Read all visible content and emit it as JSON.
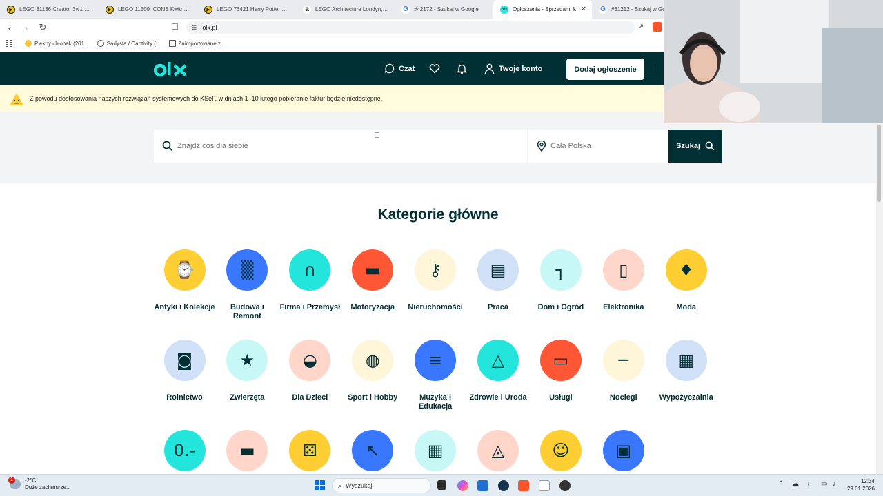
{
  "browser": {
    "tabs": [
      {
        "title": "LEGO 31136 Creator 3w1 Egzo",
        "favicon": "yt-icon",
        "active": false
      },
      {
        "title": "LEGO 11509 ICONS Kwitnący k",
        "favicon": "yt-icon",
        "active": false
      },
      {
        "title": "LEGO 76421 Harry Potter Skrz",
        "favicon": "yt-icon",
        "active": false
      },
      {
        "title": "LEGO Architecture Londyn, Dec",
        "favicon": "amazon-icon",
        "active": false
      },
      {
        "title": "#42172 - Szukaj w Google",
        "favicon": "google-icon",
        "active": false
      },
      {
        "title": "Ogłoszenia - Sprzedam, k",
        "favicon": "olx-icon",
        "active": true
      },
      {
        "title": "#31212 - Szukaj w Goo",
        "favicon": "google-icon",
        "active": false
      }
    ],
    "url": "olx.pl",
    "bookmarks": [
      {
        "label": "Piękny chłopak (201..."
      },
      {
        "label": "Sadysta / Captivity (..."
      },
      {
        "label": "Zaimportowane z..."
      }
    ]
  },
  "header": {
    "logo": "olx",
    "chat_label": "Czat",
    "account_label": "Twoje konto",
    "post_button": "Dodaj ogłoszenie"
  },
  "notice": {
    "text": "Z powodu dostosowania naszych rozwiązań systemowych do KSeF, w dniach 1–10 lutego pobieranie faktur będzie niedostępne."
  },
  "search": {
    "query_placeholder": "Znajdź coś dla siebie",
    "location_placeholder": "Cała Polska",
    "button_label": "Szukaj"
  },
  "categories": {
    "title": "Kategorie główne",
    "items": [
      {
        "label": "Antyki i Kolekcje",
        "icon": "pocket-watch-icon",
        "bg": "#ffce32"
      },
      {
        "label": "Budowa i Remont",
        "icon": "brick-wall-icon",
        "bg": "#3a77ff"
      },
      {
        "label": "Firma i Przemysł",
        "icon": "headphones-icon",
        "bg": "#23e5db"
      },
      {
        "label": "Motoryzacja",
        "icon": "car-icon",
        "bg": "#ff5636"
      },
      {
        "label": "Nieruchomości",
        "icon": "keys-icon",
        "bg": "#fff6d9"
      },
      {
        "label": "Praca",
        "icon": "briefcase-icon",
        "bg": "#cfe0f7"
      },
      {
        "label": "Dom i Ogród",
        "icon": "armchair-icon",
        "bg": "#c8f8f6"
      },
      {
        "label": "Elektronika",
        "icon": "smartphone-icon",
        "bg": "#ffd6c9"
      },
      {
        "label": "Moda",
        "icon": "robe-icon",
        "bg": "#ffce32"
      },
      {
        "label": "Rolnictwo",
        "icon": "tractor-icon",
        "bg": "#cfe0f7"
      },
      {
        "label": "Zwierzęta",
        "icon": "dog-icon",
        "bg": "#c8f8f6"
      },
      {
        "label": "Dla Dzieci",
        "icon": "stroller-icon",
        "bg": "#ffd6c9"
      },
      {
        "label": "Sport i Hobby",
        "icon": "football-icon",
        "bg": "#fff6d9"
      },
      {
        "label": "Muzyka i Edukacja",
        "icon": "books-icon",
        "bg": "#3a77ff"
      },
      {
        "label": "Zdrowie i Uroda",
        "icon": "perfume-icon",
        "bg": "#23e5db"
      },
      {
        "label": "Usługi",
        "icon": "paint-roller-icon",
        "bg": "#ff5636"
      },
      {
        "label": "Noclegi",
        "icon": "bed-icon",
        "bg": "#fff6d9"
      },
      {
        "label": "Wypożyczalnia",
        "icon": "calendar-icon",
        "bg": "#cfe0f7"
      },
      {
        "label": "",
        "icon": "price-tag-icon",
        "bg": "#23e5db"
      },
      {
        "label": "",
        "icon": "sofa-icon",
        "bg": "#ffd6c9"
      },
      {
        "label": "",
        "icon": "dice-icon",
        "bg": "#ffce32"
      },
      {
        "label": "",
        "icon": "forklift-icon",
        "bg": "#3a77ff"
      },
      {
        "label": "",
        "icon": "calculator-icon",
        "bg": "#c8f8f6"
      },
      {
        "label": "",
        "icon": "ski-goggles-icon",
        "bg": "#ffd6c9"
      },
      {
        "label": "",
        "icon": "team-icon",
        "bg": "#ffce32"
      },
      {
        "label": "",
        "icon": "van-icon",
        "bg": "#3a77ff"
      }
    ]
  },
  "taskbar": {
    "weather_temp": "-2°C",
    "weather_desc": "Duże zachmurze...",
    "weather_badge": "1",
    "search_label": "Wyszukaj",
    "time": "12:34",
    "date": "29.01.2026"
  },
  "colors": {
    "olx_dark": "#002f34",
    "olx_teal": "#23e5db",
    "notice_bg": "#fffbdc",
    "search_area_bg": "#f2f4f5"
  }
}
